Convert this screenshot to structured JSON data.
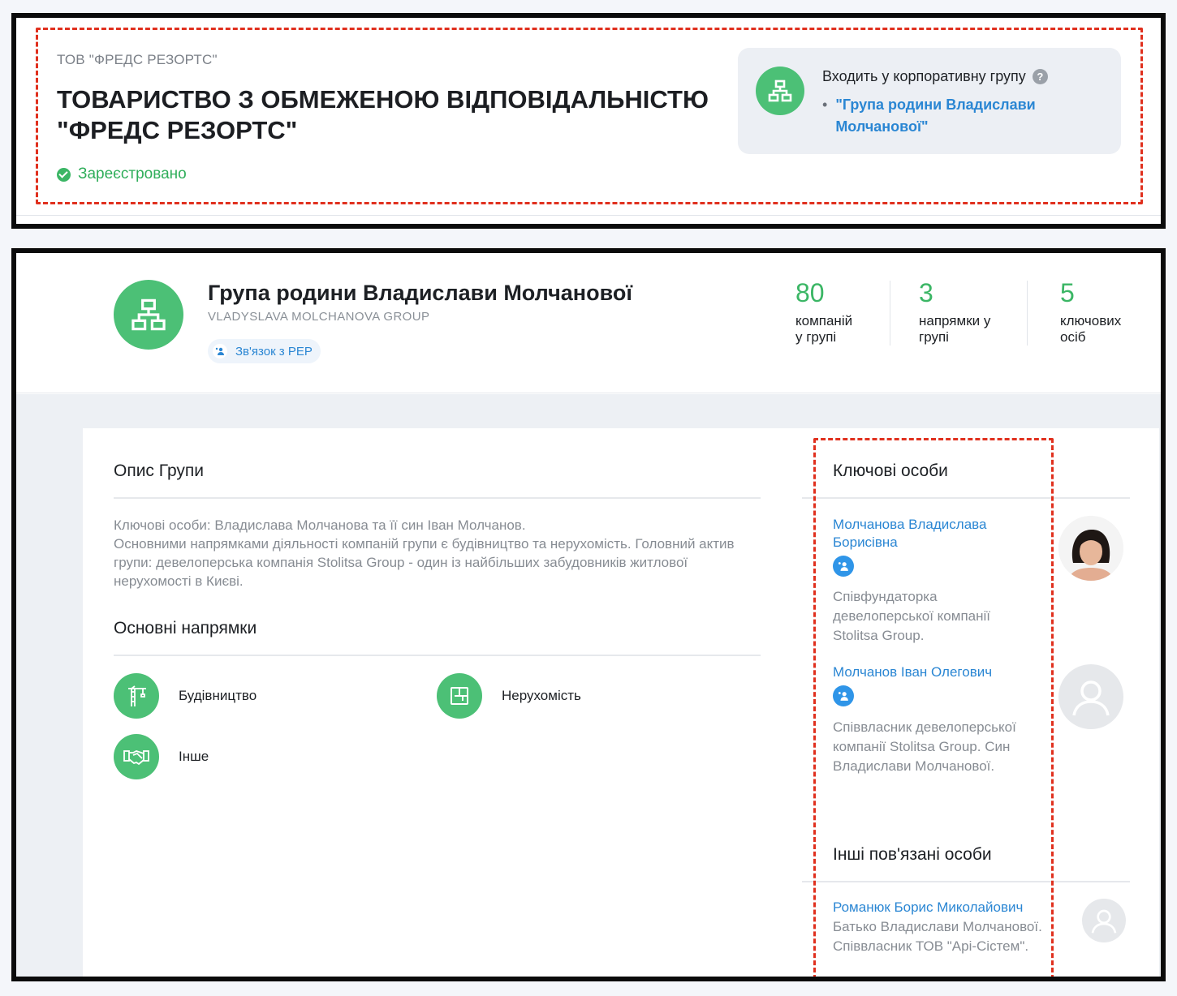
{
  "company": {
    "short_name": "ТОВ \"ФРЕДС РЕЗОРТС\"",
    "full_name": "ТОВАРИСТВО З ОБМЕЖЕНОЮ ВІДПОВІДАЛЬНІСТЮ \"ФРЕДС РЕЗОРТС\"",
    "status": "Зареєстровано",
    "group_label": "Входить у корпоративну групу",
    "group_link": "\"Група родини Владислави Молчанової\""
  },
  "group": {
    "title": "Група родини Владислави Молчанової",
    "subtitle": "VLADYSLAVA MOLCHANOVA GROUP",
    "pep_link": "Зв'язок з PEP",
    "stats": [
      {
        "num": "80",
        "label1": "компаній",
        "label2": "у групі"
      },
      {
        "num": "3",
        "label1": "напрямки у",
        "label2": "групі"
      },
      {
        "num": "5",
        "label1": "ключових",
        "label2": "осіб"
      }
    ],
    "description_title": "Опис Групи",
    "description_lines": [
      "Ключові особи: Владислава Молчанова та її син Іван Молчанов.",
      "Основними напрямками діяльності компаній групи є будівництво та нерухомість. Головний актив групи: девелоперська компанія Stolitsa Group - один із найбільших забудовників житлової нерухомості в Києві."
    ],
    "directions_title": "Основні напрямки",
    "directions": [
      "Будівництво",
      "Нерухомість",
      "Інше"
    ]
  },
  "key_persons": {
    "title": "Ключові особи",
    "persons": [
      {
        "name": "Молчанова Владислава Борисівна",
        "desc": "Співфундаторка девелоперської компанії Stolitsa Group."
      },
      {
        "name": "Молчанов Іван Олегович",
        "desc": "Співвласник девелоперської компанії Stolitsa Group. Син Владислави Молчанової."
      }
    ]
  },
  "other_persons": {
    "title": "Інші пов'язані особи",
    "persons": [
      {
        "name": "Романюк Борис Миколайович",
        "desc": "Батько Владислави Молчанової. Співвласник ТОВ \"Арі-Сістем\"."
      }
    ]
  },
  "colors": {
    "accent_green": "#4cc076",
    "link_blue": "#2a86d3",
    "annotation_red": "#e0301e"
  }
}
